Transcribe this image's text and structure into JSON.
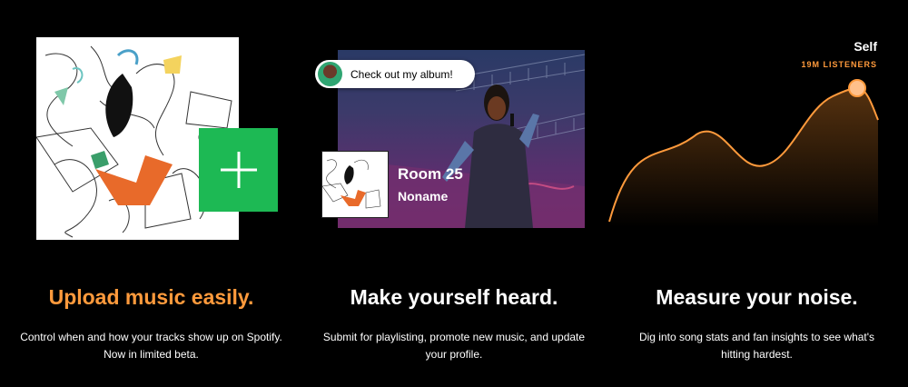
{
  "features": [
    {
      "heading": "Upload music easily.",
      "description": "Control when and how your tracks show up on Spotify. Now in limited beta.",
      "accent": "#ff9a3c"
    },
    {
      "heading": "Make yourself heard.",
      "description": "Submit for playlisting, promote new music, and update your profile.",
      "speech_bubble": "Check out my album!",
      "track": {
        "title": "Room 25",
        "artist": "Noname"
      }
    },
    {
      "heading": "Measure your noise.",
      "description": "Dig into song stats and fan insights to see what's hitting hardest.",
      "series_name": "Self",
      "listeners_label": "19M LISTENERS"
    }
  ],
  "colors": {
    "background": "#000000",
    "accent_orange": "#ff9a3c",
    "spotify_green": "#1db954"
  },
  "icons": {
    "add": "plus-icon"
  }
}
